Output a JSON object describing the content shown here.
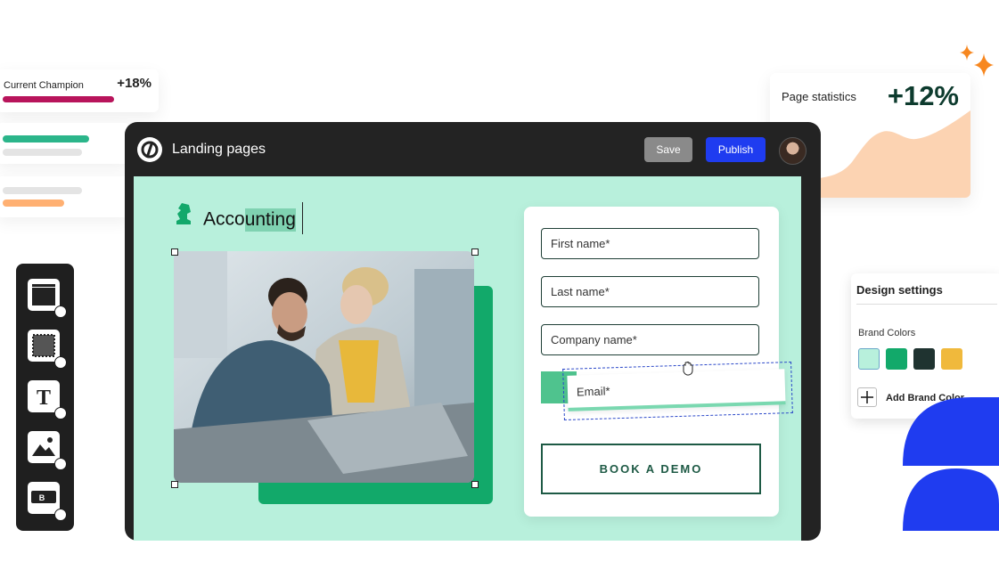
{
  "champion_card": {
    "label": "Current Champion",
    "value": "+18%"
  },
  "stats_card": {
    "label": "Page statistics",
    "value": "+12%"
  },
  "editor": {
    "title": "Landing pages",
    "save_label": "Save",
    "publish_label": "Publish",
    "brand_prefix": "Acco",
    "brand_selected": "unting"
  },
  "form": {
    "first_name_placeholder": "First name*",
    "last_name_placeholder": "Last name*",
    "company_placeholder": "Company name*",
    "email_placeholder": "Email*",
    "cta_label": "BOOK A DEMO"
  },
  "toolbar": {
    "tools": [
      "section-tool-icon",
      "box-tool-icon",
      "text-tool-icon",
      "image-tool-icon",
      "button-tool-icon"
    ]
  },
  "design_settings": {
    "title": "Design settings",
    "brand_colors_label": "Brand Colors",
    "add_label": "Add Brand Color",
    "colors": [
      "#b8f0dc",
      "#12a96a",
      "#1f3330",
      "#f0b93c"
    ]
  },
  "colors": {
    "accent_blue": "#1f3cf0",
    "accent_green": "#12a96a",
    "mint": "#b8f0dc",
    "magenta": "#b8145b",
    "orange": "#f7871f"
  }
}
